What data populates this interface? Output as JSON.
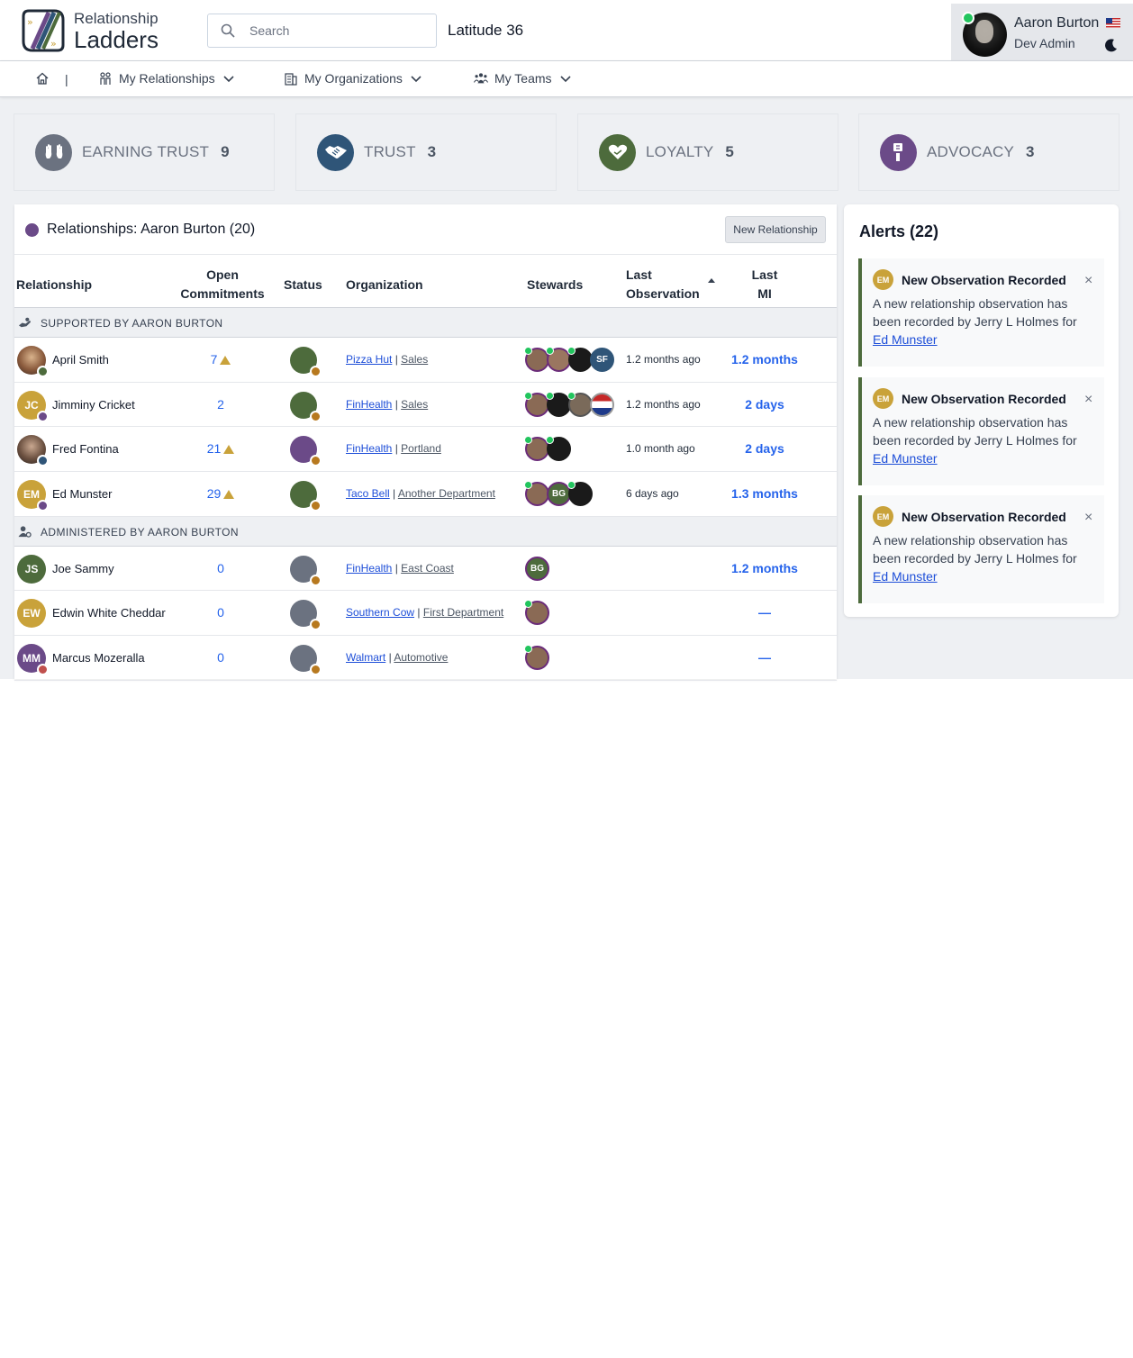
{
  "app": {
    "logo_line1": "Relationship",
    "logo_line2": "Ladders",
    "search_placeholder": "Search",
    "org_name": "Latitude 36",
    "user_name": "Aaron Burton",
    "user_role": "Dev Admin"
  },
  "nav": {
    "separator": "|",
    "relationships": "My Relationships",
    "organizations": "My Organizations",
    "teams": "My Teams"
  },
  "stages": [
    {
      "label": "EARNING TRUST",
      "count": "9",
      "color": "#6b7280"
    },
    {
      "label": "TRUST",
      "count": "3",
      "color": "#2f5578"
    },
    {
      "label": "LOYALTY",
      "count": "5",
      "color": "#4d6b3c"
    },
    {
      "label": "ADVOCACY",
      "count": "3",
      "color": "#6b4a88"
    }
  ],
  "panel": {
    "title": "Relationships: Aaron Burton (20)",
    "new_button": "New Relationship"
  },
  "table": {
    "headers": {
      "relationship": "Relationship",
      "open_1": "Open",
      "open_2": "Commitments",
      "status": "Status",
      "organization": "Organization",
      "stewards": "Stewards",
      "last_obs_1": "Last",
      "last_obs_2": "Observation",
      "last_mi_1": "Last",
      "last_mi_2": "MI"
    },
    "groups": [
      {
        "label": "SUPPORTED BY AARON BURTON"
      },
      {
        "label": "ADMINISTERED BY AARON BURTON"
      }
    ],
    "rows": [
      {
        "initials": "",
        "name": "April Smith",
        "commitments": "7",
        "org": "Pizza Hut",
        "sep": "|",
        "dept": "Sales",
        "last_obs": "1.2 months ago",
        "last_mi": "1.2 months"
      },
      {
        "initials": "JC",
        "name": "Jimminy Cricket",
        "commitments": "2",
        "org": "FinHealth",
        "sep": "|",
        "dept": "Sales",
        "last_obs": "1.2 months ago",
        "last_mi": "2 days"
      },
      {
        "initials": "",
        "name": "Fred Fontina",
        "commitments": "21",
        "org": "FinHealth",
        "sep": "|",
        "dept": "Portland",
        "last_obs": "1.0 month ago",
        "last_mi": "2 days"
      },
      {
        "initials": "EM",
        "name": "Ed Munster",
        "commitments": "29",
        "org": "Taco Bell",
        "sep": "|",
        "dept": "Another Department",
        "last_obs": "6 days ago",
        "last_mi": "1.3 months"
      },
      {
        "initials": "JS",
        "name": "Joe Sammy",
        "commitments": "0",
        "org": "FinHealth",
        "sep": "|",
        "dept": "East Coast",
        "last_obs": "",
        "last_mi": "1.2 months"
      },
      {
        "initials": "EW",
        "name": "Edwin White Cheddar",
        "commitments": "0",
        "org": "Southern Cow",
        "sep": "|",
        "dept": "First Department",
        "last_obs": "",
        "last_mi": "—"
      },
      {
        "initials": "MM",
        "name": "Marcus Mozeralla",
        "commitments": "0",
        "org": "Walmart",
        "sep": "|",
        "dept": "Automotive",
        "last_obs": "",
        "last_mi": "—"
      }
    ],
    "steward_labels": {
      "sf": "SF",
      "bg": "BG"
    }
  },
  "alerts": {
    "title": "Alerts (22)",
    "items": [
      {
        "initials": "EM",
        "title": "New Observation Recorded",
        "close": "×",
        "body": "A new relationship observation has been recorded by Jerry L Holmes for",
        "link": "Ed Munster"
      },
      {
        "initials": "EM",
        "title": "New Observation Recorded",
        "close": "×",
        "body": "A new relationship observation has been recorded by Jerry L Holmes for",
        "link": "Ed Munster"
      },
      {
        "initials": "EM",
        "title": "New Observation Recorded",
        "close": "×",
        "body": "A new relationship observation has been recorded by Jerry L Holmes for",
        "link": "Ed Munster"
      }
    ]
  }
}
